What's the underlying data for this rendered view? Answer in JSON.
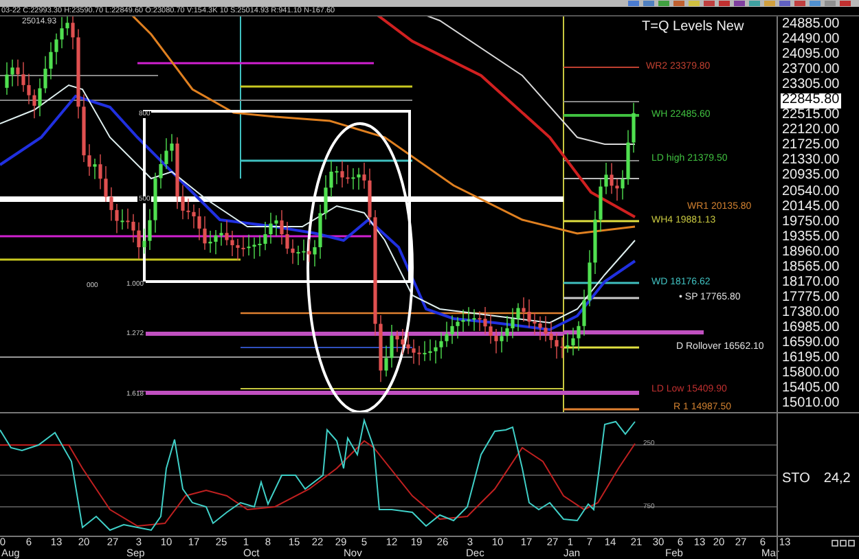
{
  "header": {
    "info": "03-22 C:22993.30 H:23590.70 L:22849.60 O:23080.70 V:154.3K 10 S:25014.93 R:941.10 N-167.60"
  },
  "chart": {
    "title": "T=Q Levels New",
    "high_label": "25014.93",
    "price_axis": [
      {
        "text": "24885.00",
        "selected": false
      },
      {
        "text": "24490.00",
        "selected": false
      },
      {
        "text": "24095.00",
        "selected": false
      },
      {
        "text": "23700.00",
        "selected": false
      },
      {
        "text": "23305.00",
        "selected": false
      },
      {
        "text": "22845.80",
        "selected": true
      },
      {
        "text": "22515.00",
        "selected": false
      },
      {
        "text": "22120.00",
        "selected": false
      },
      {
        "text": "21725.00",
        "selected": false
      },
      {
        "text": "21330.00",
        "selected": false
      },
      {
        "text": "20935.00",
        "selected": false
      },
      {
        "text": "20540.00",
        "selected": false
      },
      {
        "text": "20145.00",
        "selected": false
      },
      {
        "text": "19750.00",
        "selected": false
      },
      {
        "text": "19355.00",
        "selected": false
      },
      {
        "text": "18960.00",
        "selected": false
      },
      {
        "text": "18565.00",
        "selected": false
      },
      {
        "text": "18170.00",
        "selected": false
      },
      {
        "text": "17775.00",
        "selected": false
      },
      {
        "text": "17380.00",
        "selected": false
      },
      {
        "text": "16985.00",
        "selected": false
      },
      {
        "text": "16590.00",
        "selected": false
      },
      {
        "text": "16195.00",
        "selected": false
      },
      {
        "text": "15800.00",
        "selected": false
      },
      {
        "text": "15405.00",
        "selected": false
      },
      {
        "text": "15010.00",
        "selected": false
      }
    ],
    "levels": [
      {
        "label": "WR2 23379.80",
        "color": "#c04030"
      },
      {
        "label": "WH 22485.60",
        "color": "#40c040"
      },
      {
        "label": "LD high 21379.50",
        "color": "#40c040"
      },
      {
        "label": "WR1 20135.80",
        "color": "#d08030"
      },
      {
        "label": "WH4 19881.13",
        "color": "#c8c840"
      },
      {
        "label": "WD 18176.62",
        "color": "#40c0c0"
      },
      {
        "label": "• SP 17765.80",
        "color": "#e0e0e0"
      },
      {
        "label": "D Rollover 16562.10",
        "color": "#e0e0e0"
      },
      {
        "label": "LD Low 15409.90",
        "color": "#c03030"
      },
      {
        "label": "R 1 14987.50",
        "color": "#d08030"
      }
    ],
    "fib_labels": [
      "800",
      "500",
      "1.000",
      "000",
      "1.272",
      "1.618"
    ]
  },
  "oscillator": {
    "name": "STO",
    "value": "24,2",
    "ticks": [
      "250",
      "750"
    ]
  },
  "date_axis": {
    "days": [
      "0",
      "6",
      "13",
      "20",
      "27",
      "3",
      "10",
      "17",
      "25",
      "1",
      "8",
      "15",
      "22",
      "29",
      "5",
      "12",
      "19",
      "26",
      "3",
      "10",
      "17",
      "27",
      "1",
      "7",
      "14",
      "21",
      "30",
      "6",
      "13",
      "20",
      "27",
      "6",
      "13"
    ],
    "months": [
      "Aug",
      "Sep",
      "Oct",
      "Nov",
      "Dec",
      "Jan",
      "Feb",
      "Mar"
    ]
  }
}
